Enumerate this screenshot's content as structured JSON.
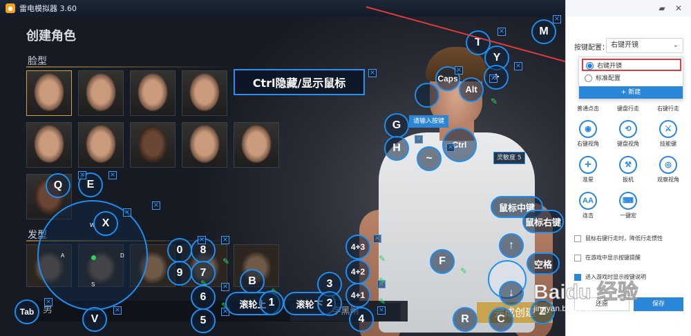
{
  "titlebar": {
    "title": "雷电模拟器 3.60"
  },
  "game": {
    "heading": "创建角色",
    "face_section": "脸型",
    "hair_section": "发型",
    "gender": "男",
    "confirm": "字黑闸",
    "finish": "完成创建",
    "hair_dirs": [
      "A",
      "D",
      "S",
      "W"
    ]
  },
  "overlay": {
    "toggle_cursor_label": "Ctrl隐藏/显示鼠标",
    "key_prompt": "请输入按键",
    "sensitivity": "灵敏度 5",
    "keys": {
      "M": "M",
      "T": "T",
      "Y": "Y",
      "Caps": "Caps",
      "Alt": "Alt",
      "G": "G",
      "H": "H",
      "tilde": "~",
      "Ctrl": "Ctrl",
      "Q": "Q",
      "E": "E",
      "X": "X",
      "zero": "0",
      "eight": "8",
      "nine": "9",
      "seven": "7",
      "six": "6",
      "five": "5",
      "B": "B",
      "three": "3",
      "two": "2",
      "one": "1",
      "four": "4",
      "four_plus_three": "4+3",
      "four_plus_two": "4+2",
      "four_plus_one": "4+1",
      "F": "F",
      "R": "R",
      "C": "C",
      "V": "V",
      "Tab": "Tab",
      "Z": "Z",
      "up": "↑",
      "down": "↓",
      "plus": "+"
    },
    "pills": {
      "middle_mouse": "鼠标中键",
      "right_mouse": "鼠标右键",
      "space": "空格",
      "wheel_up": "滚轮上",
      "wheel_down": "滚轮下"
    }
  },
  "panel": {
    "config_label": "按键配置：",
    "config_value": "右键开镜",
    "options": [
      "右键开镜",
      "标准配置"
    ],
    "new_button": "+ 新建",
    "tools": [
      {
        "icon": "single-click-icon",
        "label": "普通点击"
      },
      {
        "icon": "keyboard-walk-icon",
        "label": "键盘行走"
      },
      {
        "icon": "right-walk-icon",
        "label": "右键行走"
      },
      {
        "icon": "right-view-icon",
        "label": "右键视角"
      },
      {
        "icon": "keyboard-view-icon",
        "label": "键盘视角"
      },
      {
        "icon": "skill-icon",
        "label": "技能键"
      },
      {
        "icon": "crosshair-icon",
        "label": "准星"
      },
      {
        "icon": "trigger-icon",
        "label": "扳机"
      },
      {
        "icon": "observe-icon",
        "label": "观察视角"
      },
      {
        "icon": "combo-icon",
        "label": "连击"
      },
      {
        "icon": "macro-icon",
        "label": "一键宏"
      }
    ],
    "tool_glyphs": [
      "●",
      "⟳",
      "↗",
      "◉",
      "⟲",
      "⚔",
      "✛",
      "⚒",
      "◎",
      "AA",
      "⌨"
    ],
    "checkbox_1": "鼠标右键行走时，降低行走惯性",
    "checkbox_2": "在游戏中显示按键提醒",
    "checkbox_3": "进入游戏时显示按键说明",
    "restore_button": "还原",
    "save_button": "保存"
  },
  "watermark": {
    "main": "Baidu 经验",
    "sub": "jingyan.baidu.com"
  },
  "colors": {
    "accent": "#1e8ff0",
    "panel_blue": "#2a86d8",
    "highlight_red": "#e23b3b",
    "gold": "#c8a450"
  }
}
